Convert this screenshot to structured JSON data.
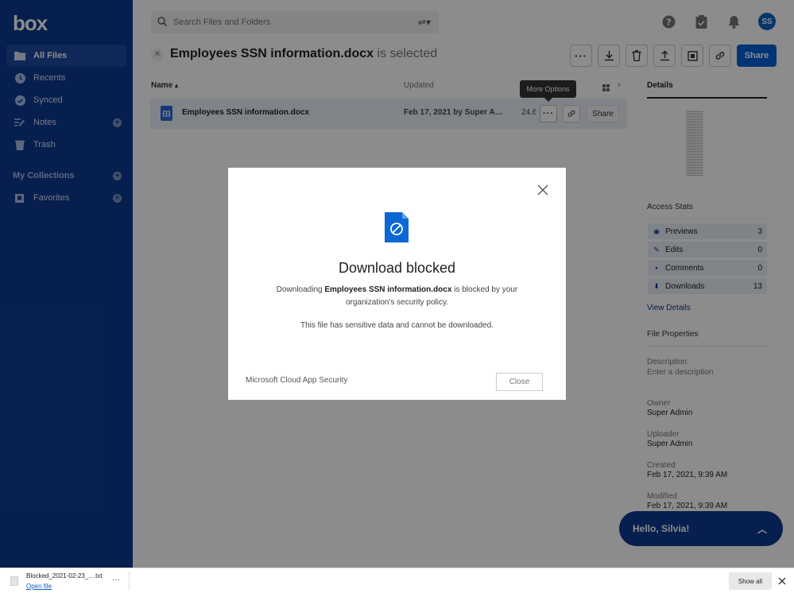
{
  "brand": {
    "logo": "box"
  },
  "sidebar": {
    "items": [
      {
        "label": "All Files",
        "icon": "folder-icon"
      },
      {
        "label": "Recents",
        "icon": "clock-icon"
      },
      {
        "label": "Synced",
        "icon": "check-circle-icon"
      },
      {
        "label": "Notes",
        "icon": "notes-icon"
      },
      {
        "label": "Trash",
        "icon": "trash-icon"
      },
      {
        "label": "My Collections",
        "icon": "none"
      },
      {
        "label": "Favorites",
        "icon": "favorites-icon"
      }
    ]
  },
  "search": {
    "placeholder": "Search Files and Folders"
  },
  "header": {
    "title": "Employees SSN information.docx",
    "title_suffix": "is selected",
    "share_label": "Share"
  },
  "list": {
    "col_name": "Name",
    "col_updated": "Updated",
    "row": {
      "name": "Employees SSN information.docx",
      "updated": "Feb 17, 2021 by Super Admin",
      "size": "24.6",
      "share_label": "Share"
    },
    "tooltip": "More Options"
  },
  "details": {
    "title": "Details",
    "access_stats_label": "Access Stats",
    "stats": [
      {
        "label": "Previews",
        "value": "3"
      },
      {
        "label": "Edits",
        "value": "0"
      },
      {
        "label": "Comments",
        "value": "0"
      },
      {
        "label": "Downloads",
        "value": "13"
      }
    ],
    "view_details": "View Details",
    "file_properties": "File Properties",
    "description_label": "Description",
    "description_placeholder": "Enter a description",
    "owner_label": "Owner",
    "owner": "Super Admin",
    "uploader_label": "Uploader",
    "uploader": "Super Admin",
    "created_label": "Created",
    "created": "Feb 17, 2021, 9:39 AM",
    "modified_label": "Modified",
    "modified": "Feb 17, 2021, 9:39 AM"
  },
  "hello": {
    "text": "Hello, Silvia!"
  },
  "modal": {
    "title": "Download blocked",
    "text_prefix": "Downloading",
    "text_file": "Employees SSN information.docx",
    "text_suffix": "is blocked by your organization's security policy.",
    "sub": "This file has sensitive data and cannot be downloaded.",
    "footer": "Microsoft Cloud App Security",
    "close_label": "Close"
  },
  "avatar": {
    "initials": "SS"
  },
  "download_bar": {
    "file_name": "Blocked_2021-02-23_....txt",
    "open_label": "Open file",
    "show_all": "Show all"
  },
  "colors": {
    "sidebar": "#0b3a8f",
    "accent": "#0061d5"
  }
}
